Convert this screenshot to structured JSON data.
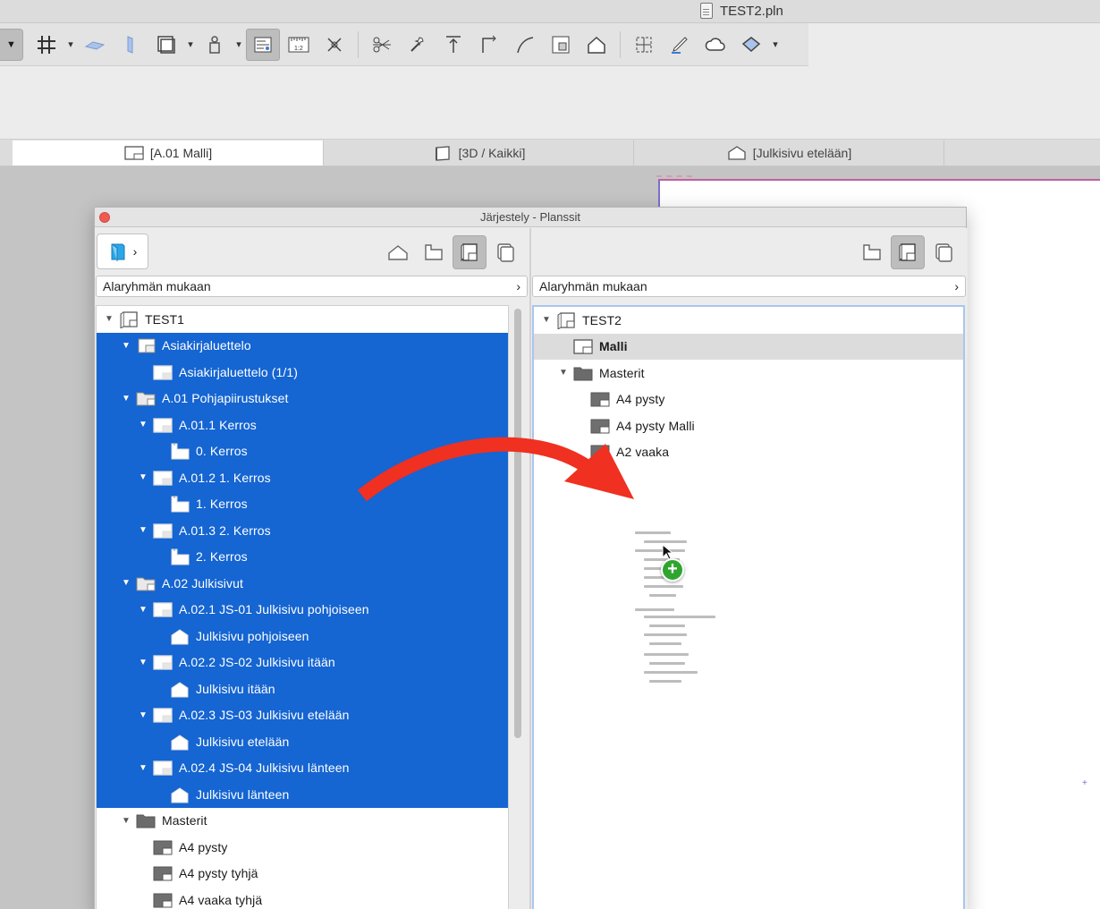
{
  "window": {
    "file_name": "TEST2.pln"
  },
  "toolbar": {
    "icons": [
      "grid-snap-icon",
      "slab-icon",
      "column-icon",
      "object-icon",
      "figure-icon",
      "sheet-layout-icon",
      "ruler-icon",
      "mirror-icon",
      "split-icon",
      "magic-wand-icon",
      "elevate-icon",
      "offset-icon",
      "curve-icon",
      "resize-icon",
      "roof-icon",
      "grid-element-icon",
      "pencil-icon",
      "cloud-icon",
      "render-icon"
    ]
  },
  "tabs": [
    {
      "label": "[A.01 Malli]",
      "active": true
    },
    {
      "label": "[3D / Kaikki]",
      "active": false
    },
    {
      "label": "[Julkisivu etelään]",
      "active": false
    }
  ],
  "organizer": {
    "title": "Järjestely - Planssit",
    "left": {
      "group_by": "Alaryhmän mukaan",
      "tree": [
        {
          "label": "TEST1",
          "level": 0,
          "icon": "book",
          "expanded": true,
          "selected": false
        },
        {
          "label": "Asiakirjaluettelo",
          "level": 1,
          "icon": "subset",
          "expanded": true,
          "selected": true
        },
        {
          "label": "Asiakirjaluettelo (1/1)",
          "level": 2,
          "icon": "layout",
          "selected": true
        },
        {
          "label": "A.01 Pohjapiirustukset",
          "level": 1,
          "icon": "folder-doc",
          "expanded": true,
          "selected": true
        },
        {
          "label": "A.01.1 Kerros",
          "level": 2,
          "icon": "layout",
          "expanded": true,
          "selected": true
        },
        {
          "label": "0. Kerros",
          "level": 3,
          "icon": "plan",
          "selected": true
        },
        {
          "label": "A.01.2 1. Kerros",
          "level": 2,
          "icon": "layout",
          "expanded": true,
          "selected": true
        },
        {
          "label": "1. Kerros",
          "level": 3,
          "icon": "plan",
          "selected": true
        },
        {
          "label": "A.01.3 2. Kerros",
          "level": 2,
          "icon": "layout",
          "expanded": true,
          "selected": true
        },
        {
          "label": "2. Kerros",
          "level": 3,
          "icon": "plan",
          "selected": true
        },
        {
          "label": "A.02 Julkisivut",
          "level": 1,
          "icon": "folder-doc",
          "expanded": true,
          "selected": true
        },
        {
          "label": "A.02.1 JS-01 Julkisivu pohjoiseen",
          "level": 2,
          "icon": "layout",
          "expanded": true,
          "selected": true
        },
        {
          "label": "Julkisivu pohjoiseen",
          "level": 3,
          "icon": "elevation",
          "selected": true
        },
        {
          "label": "A.02.2 JS-02 Julkisivu itään",
          "level": 2,
          "icon": "layout",
          "expanded": true,
          "selected": true
        },
        {
          "label": "Julkisivu itään",
          "level": 3,
          "icon": "elevation",
          "selected": true
        },
        {
          "label": "A.02.3 JS-03 Julkisivu etelään",
          "level": 2,
          "icon": "layout",
          "expanded": true,
          "selected": true
        },
        {
          "label": "Julkisivu etelään",
          "level": 3,
          "icon": "elevation",
          "selected": true
        },
        {
          "label": "A.02.4 JS-04 Julkisivu länteen",
          "level": 2,
          "icon": "layout",
          "expanded": true,
          "selected": true
        },
        {
          "label": "Julkisivu länteen",
          "level": 3,
          "icon": "elevation",
          "selected": true
        },
        {
          "label": "Masterit",
          "level": 1,
          "icon": "folder",
          "expanded": true,
          "selected": false
        },
        {
          "label": "A4 pysty",
          "level": 2,
          "icon": "master",
          "selected": false
        },
        {
          "label": "A4 pysty tyhjä",
          "level": 2,
          "icon": "master",
          "selected": false
        },
        {
          "label": "A4 vaaka tyhjä",
          "level": 2,
          "icon": "master",
          "selected": false
        }
      ]
    },
    "right": {
      "group_by": "Alaryhmän mukaan",
      "tree": [
        {
          "label": "TEST2",
          "level": 0,
          "icon": "book",
          "expanded": true,
          "selected": false
        },
        {
          "label": "Malli",
          "level": 1,
          "icon": "layout",
          "highlighted": true
        },
        {
          "label": "Masterit",
          "level": 1,
          "icon": "folder",
          "expanded": true
        },
        {
          "label": "A4 pysty",
          "level": 2,
          "icon": "master"
        },
        {
          "label": "A4 pysty Malli",
          "level": 2,
          "icon": "master"
        },
        {
          "label": "A2 vaaka",
          "level": 2,
          "icon": "master"
        }
      ]
    }
  },
  "drag": {
    "badge": "+"
  },
  "colors": {
    "selection": "#1565d2",
    "arrow": "#f03020",
    "badge": "#2fa52f"
  }
}
